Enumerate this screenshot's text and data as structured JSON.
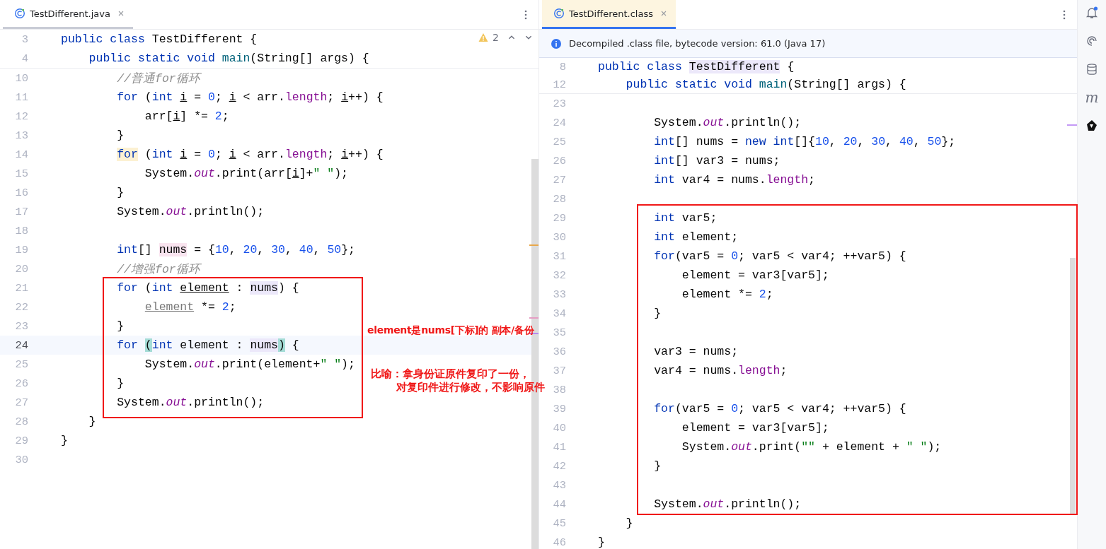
{
  "left_editor": {
    "tab": {
      "label": "TestDifferent.java",
      "selected": false
    },
    "warnings": "2",
    "sticky": [
      {
        "num": "3",
        "tokens": [
          {
            "text": "public class",
            "kind": "kw"
          },
          {
            "text": " TestDifferent {",
            "kind": "id"
          }
        ]
      },
      {
        "num": "4",
        "tokens": [
          {
            "text": "    public static void",
            "kind": "kw"
          },
          {
            "text": " main",
            "kind": "fn"
          },
          {
            "text": "(String[] args) {",
            "kind": "id"
          }
        ]
      }
    ],
    "lines": [
      {
        "num": "10",
        "current": false,
        "tokens": [
          {
            "text": "        //普通for循环",
            "kind": "cm"
          }
        ]
      },
      {
        "num": "11",
        "current": false,
        "tokens": [
          {
            "text": "        for",
            "kind": "kw"
          },
          {
            "text": " (",
            "kind": "id"
          },
          {
            "text": "int ",
            "kind": "kw"
          },
          {
            "text": "i",
            "kind": "ul"
          },
          {
            "text": " = ",
            "kind": "id"
          },
          {
            "text": "0",
            "kind": "num"
          },
          {
            "text": "; ",
            "kind": "id"
          },
          {
            "text": "i",
            "kind": "ul"
          },
          {
            "text": " < arr.",
            "kind": "id"
          },
          {
            "text": "length",
            "kind": "len"
          },
          {
            "text": "; ",
            "kind": "id"
          },
          {
            "text": "i",
            "kind": "ul"
          },
          {
            "text": "++) {",
            "kind": "id"
          }
        ]
      },
      {
        "num": "12",
        "current": false,
        "tokens": [
          {
            "text": "            arr[",
            "kind": "id"
          },
          {
            "text": "i",
            "kind": "ul"
          },
          {
            "text": "] *= ",
            "kind": "id"
          },
          {
            "text": "2",
            "kind": "num"
          },
          {
            "text": ";",
            "kind": "id"
          }
        ]
      },
      {
        "num": "13",
        "current": false,
        "tokens": [
          {
            "text": "        }",
            "kind": "id"
          }
        ]
      },
      {
        "num": "14",
        "current": false,
        "tokens": [
          {
            "text": "        for",
            "kind": "kw",
            "color": "#fcf1d2"
          },
          {
            "text": " (",
            "kind": "id"
          },
          {
            "text": "int ",
            "kind": "kw"
          },
          {
            "text": "i",
            "kind": "ul"
          },
          {
            "text": " = ",
            "kind": "id"
          },
          {
            "text": "0",
            "kind": "num"
          },
          {
            "text": "; ",
            "kind": "id"
          },
          {
            "text": "i",
            "kind": "ul"
          },
          {
            "text": " < arr.",
            "kind": "id"
          },
          {
            "text": "length",
            "kind": "len"
          },
          {
            "text": "; ",
            "kind": "id"
          },
          {
            "text": "i",
            "kind": "ul"
          },
          {
            "text": "++) {",
            "kind": "id"
          }
        ]
      },
      {
        "num": "15",
        "current": false,
        "tokens": [
          {
            "text": "            System.",
            "kind": "id"
          },
          {
            "text": "out",
            "kind": "fld"
          },
          {
            "text": ".print(arr[",
            "kind": "id"
          },
          {
            "text": "i",
            "kind": "ul"
          },
          {
            "text": "]+",
            "kind": "id"
          },
          {
            "text": "\" \"",
            "kind": "str"
          },
          {
            "text": ");",
            "kind": "id"
          }
        ]
      },
      {
        "num": "16",
        "current": false,
        "tokens": [
          {
            "text": "        }",
            "kind": "id"
          }
        ]
      },
      {
        "num": "17",
        "current": false,
        "tokens": [
          {
            "text": "        System.",
            "kind": "id"
          },
          {
            "text": "out",
            "kind": "fld"
          },
          {
            "text": ".println();",
            "kind": "id"
          }
        ]
      },
      {
        "num": "18",
        "current": false
      },
      {
        "num": "19",
        "current": false,
        "tokens": [
          {
            "text": "        int",
            "kind": "kw"
          },
          {
            "text": "[] ",
            "kind": "id"
          },
          {
            "text": "nums",
            "kind": "id",
            "color": "#f9e4ef"
          },
          {
            "text": " = {",
            "kind": "id"
          },
          {
            "text": "10",
            "kind": "num"
          },
          {
            "text": ", ",
            "kind": "id"
          },
          {
            "text": "20",
            "kind": "num"
          },
          {
            "text": ", ",
            "kind": "id"
          },
          {
            "text": "30",
            "kind": "num"
          },
          {
            "text": ", ",
            "kind": "id"
          },
          {
            "text": "40",
            "kind": "num"
          },
          {
            "text": ", ",
            "kind": "id"
          },
          {
            "text": "50",
            "kind": "num"
          },
          {
            "text": "};",
            "kind": "id"
          }
        ]
      },
      {
        "num": "20",
        "current": false,
        "tokens": [
          {
            "text": "        //增强for循环",
            "kind": "cm"
          }
        ]
      },
      {
        "num": "21",
        "current": false,
        "tokens": [
          {
            "text": "        for",
            "kind": "kw"
          },
          {
            "text": " (",
            "kind": "id"
          },
          {
            "text": "int ",
            "kind": "kw"
          },
          {
            "text": "element",
            "kind": "ul"
          },
          {
            "text": " : ",
            "kind": "id"
          },
          {
            "text": "nums",
            "kind": "id",
            "color": "#ece8fa"
          },
          {
            "text": ") {",
            "kind": "id"
          }
        ]
      },
      {
        "num": "22",
        "current": false,
        "tokens": [
          {
            "text": "            element",
            "kind": "ulg"
          },
          {
            "text": " *= ",
            "kind": "id"
          },
          {
            "text": "2",
            "kind": "num"
          },
          {
            "text": ";",
            "kind": "id"
          }
        ]
      },
      {
        "num": "23",
        "current": false,
        "tokens": [
          {
            "text": "        }",
            "kind": "id"
          }
        ]
      },
      {
        "num": "24",
        "current": true,
        "tokens": [
          {
            "text": "        for ",
            "kind": "kw"
          },
          {
            "text": "(",
            "kind": "id",
            "color": "#a4dcd6"
          },
          {
            "text": "int",
            "kind": "kw"
          },
          {
            "text": " element : ",
            "kind": "id"
          },
          {
            "text": "nums",
            "kind": "id",
            "color": "#ece8fa"
          },
          {
            "text": ")",
            "kind": "id",
            "color": "#a4dcd6"
          },
          {
            "text": " {",
            "kind": "id"
          }
        ]
      },
      {
        "num": "25",
        "current": false,
        "tokens": [
          {
            "text": "            System.",
            "kind": "id"
          },
          {
            "text": "out",
            "kind": "fld"
          },
          {
            "text": ".print(element+",
            "kind": "id"
          },
          {
            "text": "\" \"",
            "kind": "str"
          },
          {
            "text": ");",
            "kind": "id"
          }
        ]
      },
      {
        "num": "26",
        "current": false,
        "tokens": [
          {
            "text": "        }",
            "kind": "id"
          }
        ]
      },
      {
        "num": "27",
        "current": false,
        "tokens": [
          {
            "text": "        System.",
            "kind": "id"
          },
          {
            "text": "out",
            "kind": "fld"
          },
          {
            "text": ".println();",
            "kind": "id"
          }
        ]
      },
      {
        "num": "28",
        "current": false,
        "tokens": [
          {
            "text": "    }",
            "kind": "id"
          }
        ]
      },
      {
        "num": "29",
        "current": false,
        "tokens": [
          {
            "text": "}",
            "kind": "id"
          }
        ]
      },
      {
        "num": "30",
        "current": false
      }
    ]
  },
  "right_editor": {
    "tab": {
      "label": "TestDifferent.class",
      "selected": true
    },
    "banner": "Decompiled .class file, bytecode version: 61.0 (Java 17)",
    "sticky": [
      {
        "num": "8",
        "tokens": [
          {
            "text": "public class ",
            "kind": "kw"
          },
          {
            "text": "TestDifferent",
            "kind": "id",
            "color": "#ece8fa"
          },
          {
            "text": " {",
            "kind": "id"
          }
        ]
      },
      {
        "num": "12",
        "tokens": [
          {
            "text": "    public static void ",
            "kind": "kw"
          },
          {
            "text": "main",
            "kind": "fn"
          },
          {
            "text": "(String[] args) {",
            "kind": "id"
          }
        ]
      }
    ],
    "lines": [
      {
        "num": "23"
      },
      {
        "num": "24",
        "tokens": [
          {
            "text": "        System.",
            "kind": "id"
          },
          {
            "text": "out",
            "kind": "fld"
          },
          {
            "text": ".println();",
            "kind": "id"
          }
        ]
      },
      {
        "num": "25",
        "tokens": [
          {
            "text": "        int",
            "kind": "kw"
          },
          {
            "text": "[] nums = ",
            "kind": "id"
          },
          {
            "text": "new int",
            "kind": "kw"
          },
          {
            "text": "[]{",
            "kind": "id"
          },
          {
            "text": "10",
            "kind": "num"
          },
          {
            "text": ", ",
            "kind": "id"
          },
          {
            "text": "20",
            "kind": "num"
          },
          {
            "text": ", ",
            "kind": "id"
          },
          {
            "text": "30",
            "kind": "num"
          },
          {
            "text": ", ",
            "kind": "id"
          },
          {
            "text": "40",
            "kind": "num"
          },
          {
            "text": ", ",
            "kind": "id"
          },
          {
            "text": "50",
            "kind": "num"
          },
          {
            "text": "};",
            "kind": "id"
          }
        ]
      },
      {
        "num": "26",
        "tokens": [
          {
            "text": "        int",
            "kind": "kw"
          },
          {
            "text": "[] var3 = nums;",
            "kind": "id"
          }
        ]
      },
      {
        "num": "27",
        "tokens": [
          {
            "text": "        int ",
            "kind": "kw"
          },
          {
            "text": "var4 = nums.",
            "kind": "id"
          },
          {
            "text": "length",
            "kind": "len"
          },
          {
            "text": ";",
            "kind": "id"
          }
        ]
      },
      {
        "num": "28"
      },
      {
        "num": "29",
        "tokens": [
          {
            "text": "        int ",
            "kind": "kw"
          },
          {
            "text": "var5;",
            "kind": "id"
          }
        ]
      },
      {
        "num": "30",
        "tokens": [
          {
            "text": "        int ",
            "kind": "kw"
          },
          {
            "text": "element;",
            "kind": "id"
          }
        ]
      },
      {
        "num": "31",
        "tokens": [
          {
            "text": "        for",
            "kind": "kw"
          },
          {
            "text": "(var5 = ",
            "kind": "id"
          },
          {
            "text": "0",
            "kind": "num"
          },
          {
            "text": "; var5 < var4; ++var5) {",
            "kind": "id"
          }
        ]
      },
      {
        "num": "32",
        "tokens": [
          {
            "text": "            element = var3[var5];",
            "kind": "id"
          }
        ]
      },
      {
        "num": "33",
        "tokens": [
          {
            "text": "            element *= ",
            "kind": "id"
          },
          {
            "text": "2",
            "kind": "num"
          },
          {
            "text": ";",
            "kind": "id"
          }
        ]
      },
      {
        "num": "34",
        "tokens": [
          {
            "text": "        }",
            "kind": "id"
          }
        ]
      },
      {
        "num": "35"
      },
      {
        "num": "36",
        "tokens": [
          {
            "text": "        var3 = nums;",
            "kind": "id"
          }
        ]
      },
      {
        "num": "37",
        "tokens": [
          {
            "text": "        var4 = nums.",
            "kind": "id"
          },
          {
            "text": "length",
            "kind": "len"
          },
          {
            "text": ";",
            "kind": "id"
          }
        ]
      },
      {
        "num": "38"
      },
      {
        "num": "39",
        "tokens": [
          {
            "text": "        for",
            "kind": "kw"
          },
          {
            "text": "(var5 = ",
            "kind": "id"
          },
          {
            "text": "0",
            "kind": "num"
          },
          {
            "text": "; var5 < var4; ++var5) {",
            "kind": "id"
          }
        ]
      },
      {
        "num": "40",
        "tokens": [
          {
            "text": "            element = var3[var5];",
            "kind": "id"
          }
        ]
      },
      {
        "num": "41",
        "tokens": [
          {
            "text": "            System.",
            "kind": "id"
          },
          {
            "text": "out",
            "kind": "fld"
          },
          {
            "text": ".print(",
            "kind": "id"
          },
          {
            "text": "\"\"",
            "kind": "str"
          },
          {
            "text": " + element + ",
            "kind": "id"
          },
          {
            "text": "\" \"",
            "kind": "str"
          },
          {
            "text": ");",
            "kind": "id"
          }
        ]
      },
      {
        "num": "42",
        "tokens": [
          {
            "text": "        }",
            "kind": "id"
          }
        ]
      },
      {
        "num": "43"
      },
      {
        "num": "44",
        "tokens": [
          {
            "text": "        System.",
            "kind": "id"
          },
          {
            "text": "out",
            "kind": "fld"
          },
          {
            "text": ".println();",
            "kind": "id"
          }
        ]
      },
      {
        "num": "45",
        "tokens": [
          {
            "text": "    }",
            "kind": "id"
          }
        ]
      },
      {
        "num": "46",
        "tokens": [
          {
            "text": "}",
            "kind": "id"
          }
        ]
      }
    ]
  },
  "sidebar": {
    "glyph": "m"
  },
  "notes": [
    "element是nums[下标]的 副本/备份",
    "比喻：拿身份证原件复印了一份，",
    "对复印件进行修改，不影响原件"
  ]
}
